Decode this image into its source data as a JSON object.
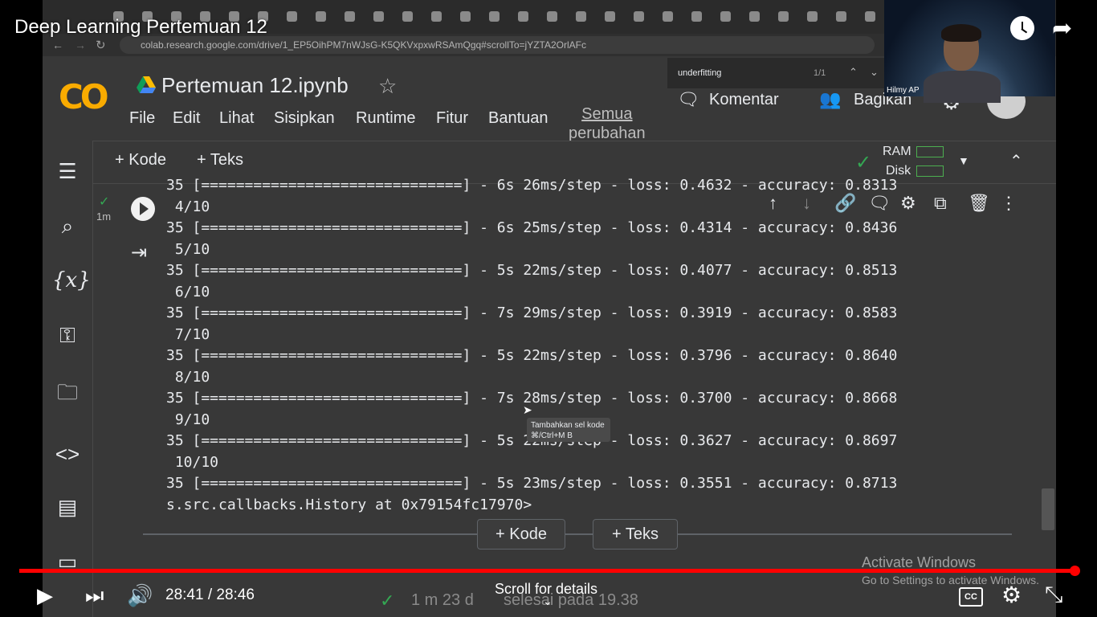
{
  "video": {
    "title": "Deep Learning Pertemuan 12",
    "time_current": "28:41",
    "time_total": "28:46",
    "time_display": "28:41 / 28:46",
    "progress_fraction": 0.997,
    "scroll_hint": "Scroll for details",
    "controls": {
      "play": "▶",
      "next": "⏭",
      "volume": "🔊",
      "cc": "CC",
      "settings": "⚙",
      "exit_fullscreen": "⤡",
      "share": "➦"
    },
    "accent_color": "#ff0000"
  },
  "webcam": {
    "name": "Hilmy AP"
  },
  "browser": {
    "url": "colab.research.google.com/drive/1_EP5OihPM7nWJsG-K5QKVxpxwRSAmQgq#scrollTo=jYZTA2OrlAFc",
    "find": {
      "query": "underfitting",
      "count": "1/1"
    }
  },
  "colab": {
    "logo": "CO",
    "notebook_title": "Pertemuan 12.ipynb",
    "menu": [
      "File",
      "Edit",
      "Lihat",
      "Sisipkan",
      "Runtime",
      "Fitur",
      "Bantuan"
    ],
    "all_changes": [
      "Semua",
      "perubahan"
    ],
    "komentar": "Komentar",
    "bagikan": "Bagikan",
    "toolbar": {
      "add_code": "+ Kode",
      "add_text": "+ Teks",
      "ram": "RAM",
      "disk": "Disk"
    },
    "cell": {
      "status": "1m"
    },
    "output_lines": [
      "35 [==============================] - 6s 26ms/step - loss: 0.4632 - accuracy: 0.8313",
      " 4/10",
      "35 [==============================] - 6s 25ms/step - loss: 0.4314 - accuracy: 0.8436",
      " 5/10",
      "35 [==============================] - 5s 22ms/step - loss: 0.4077 - accuracy: 0.8513",
      " 6/10",
      "35 [==============================] - 7s 29ms/step - loss: 0.3919 - accuracy: 0.8583",
      " 7/10",
      "35 [==============================] - 5s 22ms/step - loss: 0.3796 - accuracy: 0.8640",
      " 8/10",
      "35 [==============================] - 7s 28ms/step - loss: 0.3700 - accuracy: 0.8668",
      " 9/10",
      "35 [==============================] - 5s 22ms/step - loss: 0.3627 - accuracy: 0.8697",
      " 10/10",
      "35 [==============================] - 5s 23ms/step - loss: 0.3551 - accuracy: 0.8713",
      "s.src.callbacks.History at 0x79154fc17970>"
    ],
    "tooltip": {
      "line1": "Tambahkan sel kode",
      "line2": "⌘/Ctrl+M B"
    },
    "add_code_button": "+ Kode",
    "add_text_button": "+ Teks",
    "status_duration": "1 m 23 d",
    "status_done": "selesai pada 19.38"
  },
  "windows_watermark": {
    "line1": "Activate Windows",
    "line2": "Go to Settings to activate Windows."
  },
  "colors": {
    "colab_bg": "#383838",
    "colab_orange": "#f9ab00",
    "success_green": "#34a853"
  }
}
